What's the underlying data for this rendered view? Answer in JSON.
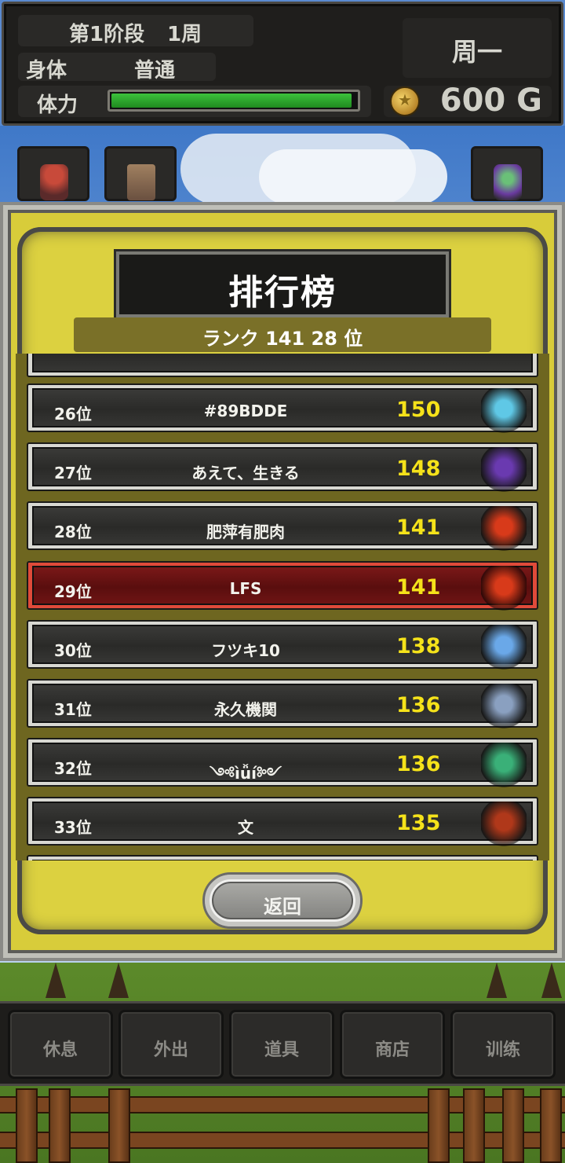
{
  "status": {
    "stage": "第1阶段",
    "week": "1周",
    "body_label": "身体",
    "body_value": "普通",
    "hp_label": "体力",
    "hp_fraction": 0.98,
    "day": "周一",
    "gold": "600 G"
  },
  "leaderboard": {
    "title": "排行榜",
    "my_rank": "ランク 141  28 位",
    "rows": [
      {
        "rank": "26位",
        "name": "#89BDDE",
        "score": "150",
        "avatar": "ice-ghost-monster-icon",
        "color": "#5fc8e6"
      },
      {
        "rank": "27位",
        "name": "あえて、生きる",
        "score": "148",
        "avatar": "purple-dragon-monster-icon",
        "color": "#6a3ab0"
      },
      {
        "rank": "28位",
        "name": "肥萍有肥肉",
        "score": "141",
        "avatar": "fire-demon-monster-icon",
        "color": "#d83a1a"
      },
      {
        "rank": "29位",
        "name": "LFS",
        "score": "141",
        "avatar": "fire-demon-monster-icon",
        "color": "#d83a1a",
        "highlight": true
      },
      {
        "rank": "30位",
        "name": "フツキ10",
        "score": "138",
        "avatar": "ice-dragon-monster-icon",
        "color": "#6aa8e8"
      },
      {
        "rank": "31位",
        "name": "永久機関",
        "score": "136",
        "avatar": "steel-golem-monster-icon",
        "color": "#8aa0c0"
      },
      {
        "rank": "32位",
        "name": "༺ìǚí༻",
        "score": "136",
        "avatar": "green-gold-mecha-monster-icon",
        "color": "#3ab078"
      },
      {
        "rank": "33位",
        "name": "文",
        "score": "135",
        "avatar": "red-dragon-monster-icon",
        "color": "#b0381a"
      }
    ],
    "back_label": "返回"
  },
  "menu": {
    "items": [
      {
        "label": "休息"
      },
      {
        "label": "外出"
      },
      {
        "label": "道具"
      },
      {
        "label": "商店"
      },
      {
        "label": "训练"
      }
    ]
  },
  "colors": {
    "panel_yellow": "#d8cc3a",
    "score_yellow": "#f5e21a",
    "highlight_red": "#7a1818",
    "hp_green": "#2fae2f"
  }
}
